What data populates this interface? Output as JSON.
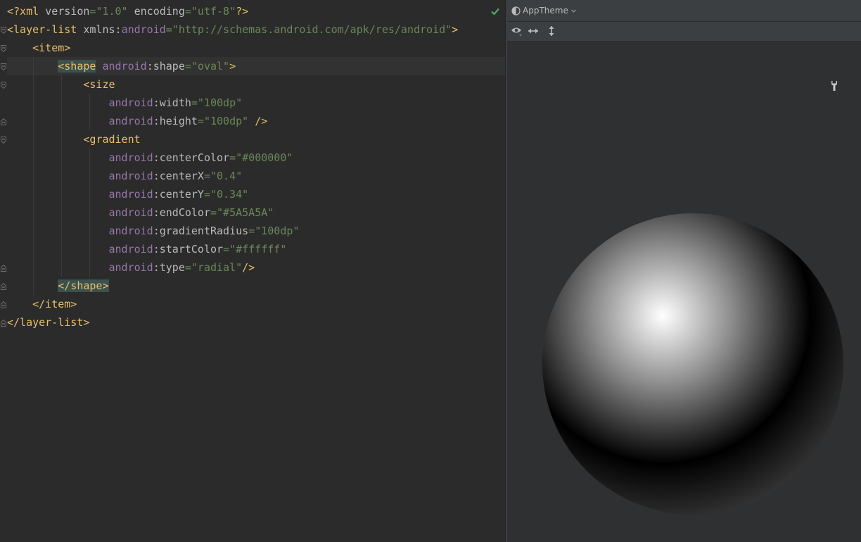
{
  "editor": {
    "lines": [
      {
        "parts": [
          {
            "c": "t-prolog",
            "t": "<?xml "
          },
          {
            "c": "t-attr",
            "t": "version"
          },
          {
            "c": "t-val",
            "t": "=\"1.0\""
          },
          {
            "c": "t-attr",
            "t": " encoding"
          },
          {
            "c": "t-val",
            "t": "=\"utf-8\""
          },
          {
            "c": "t-prolog",
            "t": "?>"
          }
        ]
      },
      {
        "parts": [
          {
            "c": "t-tag",
            "t": "<layer-list "
          },
          {
            "c": "t-attr",
            "t": "xmlns:"
          },
          {
            "c": "t-ns",
            "t": "android"
          },
          {
            "c": "t-val",
            "t": "=\"http://schemas.android.com/apk/res/android\""
          },
          {
            "c": "t-tag",
            "t": ">"
          }
        ]
      },
      {
        "parts": [
          {
            "c": "t-tag",
            "t": "    <item>"
          }
        ]
      },
      {
        "parts": [
          {
            "c": "t-attr",
            "t": "        "
          },
          {
            "c": "t-tag hl",
            "t": "<shape"
          },
          {
            "c": "t-attr",
            "t": " "
          },
          {
            "c": "t-ns",
            "t": "android"
          },
          {
            "c": "t-attr",
            "t": ":shape"
          },
          {
            "c": "t-val",
            "t": "=\"oval\""
          },
          {
            "c": "t-tag",
            "t": ">"
          }
        ]
      },
      {
        "parts": [
          {
            "c": "t-tag",
            "t": "            <size"
          }
        ]
      },
      {
        "parts": [
          {
            "c": "t-attr",
            "t": "                "
          },
          {
            "c": "t-ns",
            "t": "android"
          },
          {
            "c": "t-attr",
            "t": ":width"
          },
          {
            "c": "t-val",
            "t": "=\"100dp\""
          }
        ]
      },
      {
        "parts": [
          {
            "c": "t-attr",
            "t": "                "
          },
          {
            "c": "t-ns",
            "t": "android"
          },
          {
            "c": "t-attr",
            "t": ":height"
          },
          {
            "c": "t-val",
            "t": "=\"100dp\""
          },
          {
            "c": "t-tag",
            "t": " />"
          }
        ]
      },
      {
        "parts": [
          {
            "c": "t-tag",
            "t": "            <gradient"
          }
        ]
      },
      {
        "parts": [
          {
            "c": "t-attr",
            "t": "                "
          },
          {
            "c": "t-ns",
            "t": "android"
          },
          {
            "c": "t-attr",
            "t": ":centerColor"
          },
          {
            "c": "t-val",
            "t": "=\"#000000\""
          }
        ]
      },
      {
        "parts": [
          {
            "c": "t-attr",
            "t": "                "
          },
          {
            "c": "t-ns",
            "t": "android"
          },
          {
            "c": "t-attr",
            "t": ":centerX"
          },
          {
            "c": "t-val",
            "t": "=\"0.4\""
          }
        ]
      },
      {
        "parts": [
          {
            "c": "t-attr",
            "t": "                "
          },
          {
            "c": "t-ns",
            "t": "android"
          },
          {
            "c": "t-attr",
            "t": ":centerY"
          },
          {
            "c": "t-val",
            "t": "=\"0.34\""
          }
        ]
      },
      {
        "parts": [
          {
            "c": "t-attr",
            "t": "                "
          },
          {
            "c": "t-ns",
            "t": "android"
          },
          {
            "c": "t-attr",
            "t": ":endColor"
          },
          {
            "c": "t-val",
            "t": "=\"#5A5A5A\""
          }
        ]
      },
      {
        "parts": [
          {
            "c": "t-attr",
            "t": "                "
          },
          {
            "c": "t-ns",
            "t": "android"
          },
          {
            "c": "t-attr",
            "t": ":gradientRadius"
          },
          {
            "c": "t-val",
            "t": "=\"100dp\""
          }
        ]
      },
      {
        "parts": [
          {
            "c": "t-attr",
            "t": "                "
          },
          {
            "c": "t-ns",
            "t": "android"
          },
          {
            "c": "t-attr",
            "t": ":startColor"
          },
          {
            "c": "t-val",
            "t": "=\"#ffffff\""
          }
        ]
      },
      {
        "parts": [
          {
            "c": "t-attr",
            "t": "                "
          },
          {
            "c": "t-ns",
            "t": "android"
          },
          {
            "c": "t-attr",
            "t": ":type"
          },
          {
            "c": "t-val",
            "t": "=\"radial\""
          },
          {
            "c": "t-tag",
            "t": "/>"
          }
        ]
      },
      {
        "parts": [
          {
            "c": "t-attr",
            "t": "        "
          },
          {
            "c": "t-tag hl",
            "t": "</shape>"
          }
        ]
      },
      {
        "parts": [
          {
            "c": "t-tag",
            "t": "    </item>"
          }
        ]
      },
      {
        "parts": [
          {
            "c": "t-tag",
            "t": "</layer-list>"
          }
        ]
      }
    ],
    "status_icon": "check-icon"
  },
  "preview": {
    "theme_label": "AppTheme",
    "icons": [
      "theme-icon",
      "eye-icon",
      "resize-horizontal-icon",
      "resize-vertical-icon",
      "wrench-icon"
    ],
    "shape_colors": {
      "start": "#ffffff",
      "center": "#000000",
      "end": "#5A5A5A"
    }
  }
}
